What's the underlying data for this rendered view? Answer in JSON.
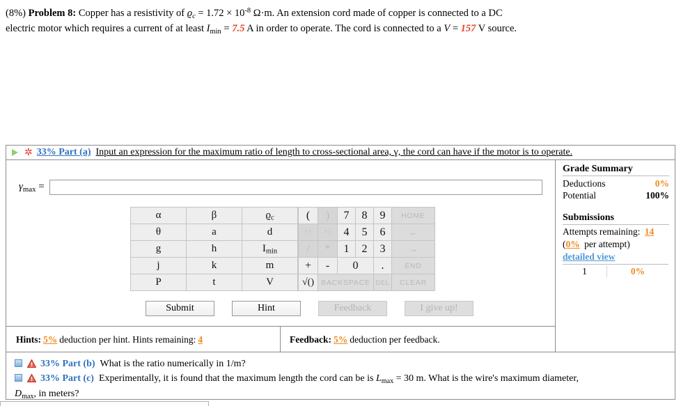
{
  "problem": {
    "percent": "(8%)",
    "label": "Problem 8:",
    "line1_a": "Copper has a resistivity of ",
    "rho_symbol": "ϱ",
    "rho_sub": "c",
    "line1_b": " = 1.72 × 10",
    "exp": "-8",
    "line1_c": " Ω·m. An extension cord made of copper is connected to a DC",
    "line2_a": "electric motor which requires a current of at least ",
    "imin_symbol": "I",
    "imin_sub": "min",
    "line2_eq": " = ",
    "imin_value": "7.5",
    "line2_b": " A in order to operate. The cord is connected to a ",
    "v_symbol": "V",
    "v_eq": " = ",
    "v_value": "157",
    "line2_c": " V source."
  },
  "part_a": {
    "percent": "33% Part (a)",
    "question": "Input an expression for the maximum ratio of length to cross-sectional area, γ, the cord can have if the motor is to operate.",
    "answer_label_symbol": "γ",
    "answer_label_sub": "max",
    "answer_label_eq": " =",
    "answer_value": "",
    "answer_placeholder": ""
  },
  "keypad": {
    "variables": [
      [
        "α",
        "β",
        "ϱc"
      ],
      [
        "θ",
        "a",
        "d"
      ],
      [
        "g",
        "h",
        "Imin"
      ],
      [
        "j",
        "k",
        "m"
      ],
      [
        "P",
        "t",
        "V"
      ]
    ],
    "var_cells": [
      {
        "label": "α",
        "sub": ""
      },
      {
        "label": "β",
        "sub": ""
      },
      {
        "label": "ϱ",
        "sub": "c"
      },
      {
        "label": "θ",
        "sub": ""
      },
      {
        "label": "a",
        "sub": ""
      },
      {
        "label": "d",
        "sub": ""
      },
      {
        "label": "g",
        "sub": ""
      },
      {
        "label": "h",
        "sub": ""
      },
      {
        "label": "I",
        "sub": "min"
      },
      {
        "label": "j",
        "sub": ""
      },
      {
        "label": "k",
        "sub": ""
      },
      {
        "label": "m",
        "sub": ""
      },
      {
        "label": "P",
        "sub": ""
      },
      {
        "label": "t",
        "sub": ""
      },
      {
        "label": "V",
        "sub": ""
      }
    ],
    "row1": [
      "(",
      ")",
      "7",
      "8",
      "9",
      "HOME"
    ],
    "row2": [
      "↑^",
      "^↓",
      "4",
      "5",
      "6",
      "←"
    ],
    "row3": [
      "/",
      "*",
      "1",
      "2",
      "3",
      "→"
    ],
    "row4": [
      "+",
      "-",
      "0",
      ".",
      "END"
    ],
    "row5": [
      "√()",
      "BACKSPACE",
      "DEL",
      "CLEAR"
    ]
  },
  "buttons": {
    "submit": "Submit",
    "hint": "Hint",
    "feedback": "Feedback",
    "give_up": "I give up!"
  },
  "hints_bar": {
    "hints_label": "Hints:",
    "hints_pct": "5%",
    "hints_text": "deduction per hint. Hints remaining:",
    "hints_remaining": "4",
    "feedback_label": "Feedback:",
    "feedback_pct": "5%",
    "feedback_text": "deduction per feedback."
  },
  "grade_summary": {
    "title": "Grade Summary",
    "deductions_label": "Deductions",
    "deductions_value": "0%",
    "potential_label": "Potential",
    "potential_value": "100%",
    "submissions_title": "Submissions",
    "attempts_label": "Attempts remaining:",
    "attempts_value": "14",
    "per_attempt_pct": "0%",
    "per_attempt_text": " per attempt)",
    "per_attempt_open": "(",
    "detailed_view": "detailed view",
    "attempt_number": "1",
    "attempt_score": "0%"
  },
  "part_b": {
    "percent": "33% Part (b)",
    "question": "What is the ratio numerically in 1/m?"
  },
  "part_c": {
    "percent": "33% Part (c)",
    "question_a": "Experimentally, it is found that the maximum length the cord can be is ",
    "lmax_symbol": "L",
    "lmax_sub": "max",
    "question_b": " = 30 m. What is the wire's maximum diameter,",
    "question_c2_symbol": "D",
    "question_c2_sub": "max",
    "question_c2_tail": ", in meters?"
  },
  "colors": {
    "red_value": "#e8442a",
    "link_blue": "#2f72c4",
    "orange": "#f08a1e",
    "detailed_blue": "#4f9ad8"
  }
}
